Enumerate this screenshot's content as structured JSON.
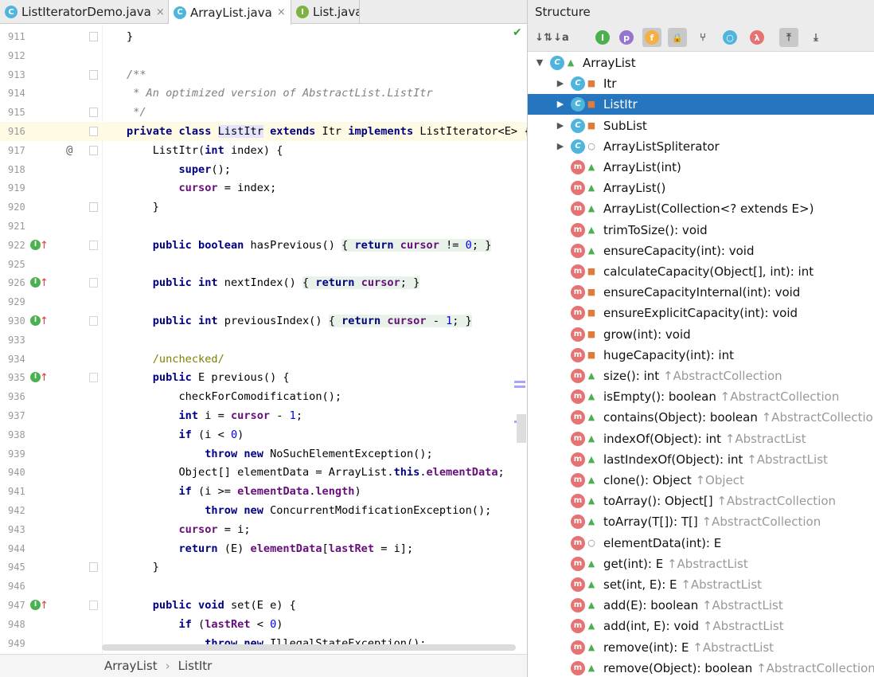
{
  "tabs": [
    {
      "label": "ListIteratorDemo.java",
      "icon": "class-icon",
      "close": "×"
    },
    {
      "label": "ArrayList.java",
      "icon": "class-icon",
      "close": "×",
      "active": true
    },
    {
      "label": "List.java",
      "icon": "interface-icon",
      "close": ""
    }
  ],
  "code_lines": [
    {
      "n": "911",
      "t": "}"
    },
    {
      "n": "912",
      "t": ""
    },
    {
      "n": "913",
      "t": "/**"
    },
    {
      "n": "914",
      "t": " * An optimized version of AbstractList.ListItr"
    },
    {
      "n": "915",
      "t": " */"
    },
    {
      "n": "916",
      "t": "private class ListItr extends Itr implements ListIterator<E> {"
    },
    {
      "n": "917",
      "t": "    ListItr(int index) {"
    },
    {
      "n": "918",
      "t": "        super();"
    },
    {
      "n": "919",
      "t": "        cursor = index;"
    },
    {
      "n": "920",
      "t": "    }"
    },
    {
      "n": "921",
      "t": ""
    },
    {
      "n": "922",
      "t": "    public boolean hasPrevious() { return cursor != 0; }"
    },
    {
      "n": "925",
      "t": ""
    },
    {
      "n": "926",
      "t": "    public int nextIndex() { return cursor; }"
    },
    {
      "n": "929",
      "t": ""
    },
    {
      "n": "930",
      "t": "    public int previousIndex() { return cursor - 1; }"
    },
    {
      "n": "933",
      "t": ""
    },
    {
      "n": "934",
      "t": "    /unchecked/"
    },
    {
      "n": "935",
      "t": "    public E previous() {"
    },
    {
      "n": "936",
      "t": "        checkForComodification();"
    },
    {
      "n": "937",
      "t": "        int i = cursor - 1;"
    },
    {
      "n": "938",
      "t": "        if (i < 0)"
    },
    {
      "n": "939",
      "t": "            throw new NoSuchElementException();"
    },
    {
      "n": "940",
      "t": "        Object[] elementData = ArrayList.this.elementData;"
    },
    {
      "n": "941",
      "t": "        if (i >= elementData.length)"
    },
    {
      "n": "942",
      "t": "            throw new ConcurrentModificationException();"
    },
    {
      "n": "943",
      "t": "        cursor = i;"
    },
    {
      "n": "944",
      "t": "        return (E) elementData[lastRet = i];"
    },
    {
      "n": "945",
      "t": "    }"
    },
    {
      "n": "946",
      "t": ""
    },
    {
      "n": "947",
      "t": "    public void set(E e) {"
    },
    {
      "n": "948",
      "t": "        if (lastRet < 0)"
    },
    {
      "n": "949",
      "t": "            throw new IllegalStateException();"
    }
  ],
  "gutter_at": "@",
  "breadcrumb": {
    "items": [
      "ArrayList",
      "ListItr"
    ],
    "sep": "›"
  },
  "structure": {
    "title": "Structure",
    "toolbar": [
      {
        "icon": "sort-by-visibility-icon",
        "glyph": "↓⇅"
      },
      {
        "icon": "sort-alphabetically-icon",
        "glyph": "↓a"
      },
      {
        "icon": "show-inherited-icon",
        "glyph": "I"
      },
      {
        "icon": "show-properties-icon",
        "glyph": "p"
      },
      {
        "icon": "show-fields-icon",
        "glyph": "f"
      },
      {
        "icon": "show-non-public-icon",
        "glyph": "🔒"
      },
      {
        "icon": "show-anonymous-icon",
        "glyph": "⑂"
      },
      {
        "icon": "show-lambdas-icon",
        "glyph": "○"
      },
      {
        "icon": "lambda-icon",
        "glyph": "λ"
      },
      {
        "icon": "autoscroll-to-source-icon",
        "glyph": "⤒"
      },
      {
        "icon": "autoscroll-from-source-icon",
        "glyph": "⤓"
      }
    ],
    "nodes": [
      {
        "label": "ArrayList",
        "type": "c",
        "access": "pub",
        "level": 0,
        "expand": "open"
      },
      {
        "label": "Itr",
        "type": "c",
        "access": "priv",
        "level": 1,
        "expand": "closed"
      },
      {
        "label": "ListItr",
        "type": "c",
        "access": "priv",
        "level": 1,
        "expand": "closed",
        "selected": true
      },
      {
        "label": "SubList",
        "type": "c",
        "access": "priv",
        "level": 1,
        "expand": "closed"
      },
      {
        "label": "ArrayListSpliterator",
        "type": "c",
        "access": "pkg",
        "level": 1,
        "expand": "closed"
      },
      {
        "label": "ArrayList(int)",
        "type": "m",
        "access": "pub",
        "level": 1
      },
      {
        "label": "ArrayList()",
        "type": "m",
        "access": "pub",
        "level": 1
      },
      {
        "label": "ArrayList(Collection<? extends E>)",
        "type": "m",
        "access": "pub",
        "level": 1
      },
      {
        "label": "trimToSize(): void",
        "type": "m",
        "access": "pub",
        "level": 1
      },
      {
        "label": "ensureCapacity(int): void",
        "type": "m",
        "access": "pub",
        "level": 1
      },
      {
        "label": "calculateCapacity(Object[], int): int",
        "type": "m",
        "access": "priv",
        "level": 1
      },
      {
        "label": "ensureCapacityInternal(int): void",
        "type": "m",
        "access": "priv",
        "level": 1
      },
      {
        "label": "ensureExplicitCapacity(int): void",
        "type": "m",
        "access": "priv",
        "level": 1
      },
      {
        "label": "grow(int): void",
        "type": "m",
        "access": "priv",
        "level": 1
      },
      {
        "label": "hugeCapacity(int): int",
        "type": "m",
        "access": "priv",
        "level": 1
      },
      {
        "label": "size(): int",
        "inh": "↑AbstractCollection",
        "type": "m",
        "access": "pub",
        "level": 1
      },
      {
        "label": "isEmpty(): boolean",
        "inh": "↑AbstractCollection",
        "type": "m",
        "access": "pub",
        "level": 1
      },
      {
        "label": "contains(Object): boolean",
        "inh": "↑AbstractCollection",
        "type": "m",
        "access": "pub",
        "level": 1
      },
      {
        "label": "indexOf(Object): int",
        "inh": "↑AbstractList",
        "type": "m",
        "access": "pub",
        "level": 1
      },
      {
        "label": "lastIndexOf(Object): int",
        "inh": "↑AbstractList",
        "type": "m",
        "access": "pub",
        "level": 1
      },
      {
        "label": "clone(): Object",
        "inh": "↑Object",
        "type": "m",
        "access": "pub",
        "level": 1
      },
      {
        "label": "toArray(): Object[]",
        "inh": "↑AbstractCollection",
        "type": "m",
        "access": "pub",
        "level": 1
      },
      {
        "label": "toArray(T[]): T[]",
        "inh": "↑AbstractCollection",
        "type": "m",
        "access": "pub",
        "level": 1
      },
      {
        "label": "elementData(int): E",
        "type": "m",
        "access": "pkg",
        "level": 1
      },
      {
        "label": "get(int): E",
        "inh": "↑AbstractList",
        "type": "m",
        "access": "pub",
        "level": 1
      },
      {
        "label": "set(int, E): E",
        "inh": "↑AbstractList",
        "type": "m",
        "access": "pub",
        "level": 1
      },
      {
        "label": "add(E): boolean",
        "inh": "↑AbstractList",
        "type": "m",
        "access": "pub",
        "level": 1
      },
      {
        "label": "add(int, E): void",
        "inh": "↑AbstractList",
        "type": "m",
        "access": "pub",
        "level": 1
      },
      {
        "label": "remove(int): E",
        "inh": "↑AbstractList",
        "type": "m",
        "access": "pub",
        "level": 1
      },
      {
        "label": "remove(Object): boolean",
        "inh": "↑AbstractCollection",
        "type": "m",
        "access": "pub",
        "level": 1
      }
    ]
  },
  "colors": {
    "selection": "#2675bf",
    "keyword": "#000080",
    "field": "#660e7a",
    "number": "#0000ff",
    "comment": "#808080"
  }
}
